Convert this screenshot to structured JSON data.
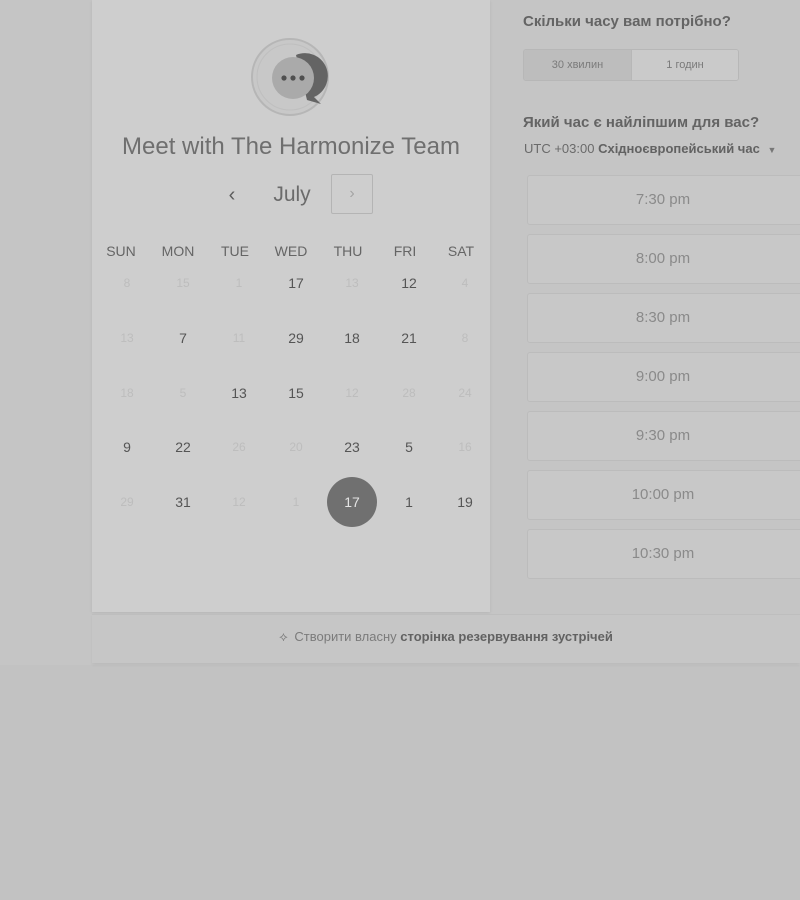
{
  "booking": {
    "title": "Meet with The Harmonize Team",
    "month": "July",
    "prev_icon": "‹",
    "next_icon": "›"
  },
  "weekdays": [
    "SUN",
    "MON",
    "TUE",
    "WED",
    "THU",
    "FRI",
    "SAT"
  ],
  "calendar": [
    [
      {
        "d": "8",
        "s": "muted"
      },
      {
        "d": "15",
        "s": "muted"
      },
      {
        "d": "1",
        "s": "muted"
      },
      {
        "d": "17",
        "s": "active"
      },
      {
        "d": "13",
        "s": "muted"
      },
      {
        "d": "12",
        "s": "active"
      },
      {
        "d": "4",
        "s": "muted"
      }
    ],
    [
      {
        "d": "13",
        "s": "muted"
      },
      {
        "d": "7",
        "s": "active"
      },
      {
        "d": "11",
        "s": "muted"
      },
      {
        "d": "29",
        "s": "active"
      },
      {
        "d": "18",
        "s": "active"
      },
      {
        "d": "21",
        "s": "active"
      },
      {
        "d": "8",
        "s": "muted"
      }
    ],
    [
      {
        "d": "18",
        "s": "muted"
      },
      {
        "d": "5",
        "s": "muted"
      },
      {
        "d": "13",
        "s": "active"
      },
      {
        "d": "15",
        "s": "active"
      },
      {
        "d": "12",
        "s": "muted"
      },
      {
        "d": "28",
        "s": "muted"
      },
      {
        "d": "24",
        "s": "muted"
      }
    ],
    [
      {
        "d": "9",
        "s": "active"
      },
      {
        "d": "22",
        "s": "active"
      },
      {
        "d": "26",
        "s": "muted"
      },
      {
        "d": "20",
        "s": "muted"
      },
      {
        "d": "23",
        "s": "active"
      },
      {
        "d": "5",
        "s": "active"
      },
      {
        "d": "16",
        "s": "muted"
      }
    ],
    [
      {
        "d": "29",
        "s": "muted"
      },
      {
        "d": "31",
        "s": "active"
      },
      {
        "d": "12",
        "s": "muted"
      },
      {
        "d": "1",
        "s": "muted"
      },
      {
        "d": "17",
        "s": "selected"
      },
      {
        "d": "1",
        "s": "active"
      },
      {
        "d": "19",
        "s": "active"
      }
    ]
  ],
  "duration": {
    "title": "Скільки часу вам потрібно?",
    "options": [
      "30 хвилин",
      "1 годин"
    ],
    "selected": "30 хвилин"
  },
  "times": {
    "title": "Який час є найліпшим для вас?",
    "timezone_offset": "UTC +03:00",
    "timezone_name": "Східноєвропейський час",
    "slots": [
      "7:30 pm",
      "8:00 pm",
      "8:30 pm",
      "9:00 pm",
      "9:30 pm",
      "10:00 pm",
      "10:30 pm"
    ]
  },
  "footer": {
    "prefix": "Створити власну",
    "link": "сторінка резервування зустрічей"
  },
  "colors": {
    "selected_day_bg": "#707070",
    "background": "#c2c2c2"
  }
}
